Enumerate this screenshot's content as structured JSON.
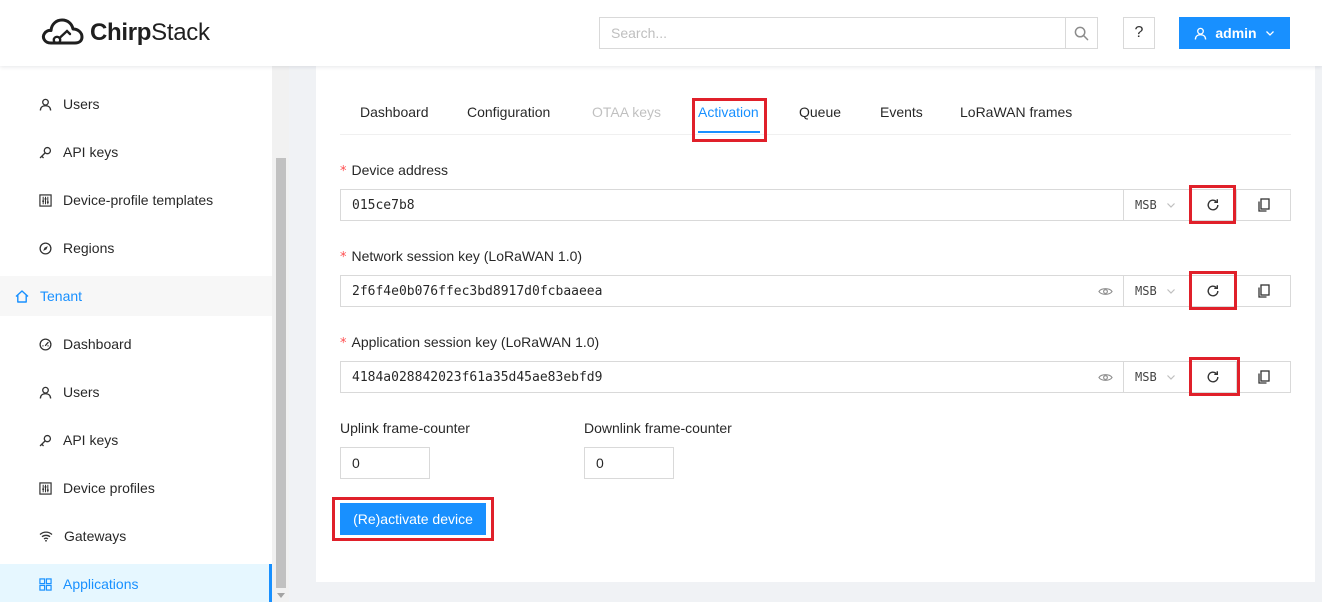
{
  "header": {
    "logo_bold": "Chirp",
    "logo_rest": "Stack",
    "search_placeholder": "Search...",
    "help_label": "?",
    "user_label": "admin"
  },
  "sidebar": {
    "items": [
      {
        "label": "Users",
        "icon": "user-icon"
      },
      {
        "label": "API keys",
        "icon": "key-icon"
      },
      {
        "label": "Device-profile templates",
        "icon": "sliders-icon"
      },
      {
        "label": "Regions",
        "icon": "compass-icon"
      }
    ],
    "tenant_group": {
      "label": "Tenant",
      "icon": "home-icon"
    },
    "tenant_items": [
      {
        "label": "Dashboard",
        "icon": "dashboard-icon"
      },
      {
        "label": "Users",
        "icon": "user-icon"
      },
      {
        "label": "API keys",
        "icon": "key-icon"
      },
      {
        "label": "Device profiles",
        "icon": "sliders-icon"
      },
      {
        "label": "Gateways",
        "icon": "wifi-icon"
      },
      {
        "label": "Applications",
        "icon": "appstore-icon"
      }
    ]
  },
  "tabs": [
    {
      "label": "Dashboard",
      "state": "normal"
    },
    {
      "label": "Configuration",
      "state": "normal"
    },
    {
      "label": "OTAA keys",
      "state": "disabled"
    },
    {
      "label": "Activation",
      "state": "active"
    },
    {
      "label": "Queue",
      "state": "normal"
    },
    {
      "label": "Events",
      "state": "normal"
    },
    {
      "label": "LoRaWAN frames",
      "state": "normal"
    }
  ],
  "form": {
    "required_mark": "*",
    "device_address": {
      "label": "Device address",
      "value": "015ce7b8",
      "byte_order": "MSB"
    },
    "nwk_s_key": {
      "label": "Network session key (LoRaWAN 1.0)",
      "value": "2f6f4e0b076ffec3bd8917d0fcbaaeea",
      "byte_order": "MSB"
    },
    "app_s_key": {
      "label": "Application session key (LoRaWAN 1.0)",
      "value": "4184a028842023f61a35d45ae83ebfd9",
      "byte_order": "MSB"
    },
    "uplink_fcnt": {
      "label": "Uplink frame-counter",
      "value": "0"
    },
    "downlink_fcnt": {
      "label": "Downlink frame-counter",
      "value": "0"
    },
    "submit_label": "(Re)activate device"
  },
  "colors": {
    "primary": "#1890ff",
    "highlight": "#e0202a",
    "required": "#ff4d4f"
  }
}
